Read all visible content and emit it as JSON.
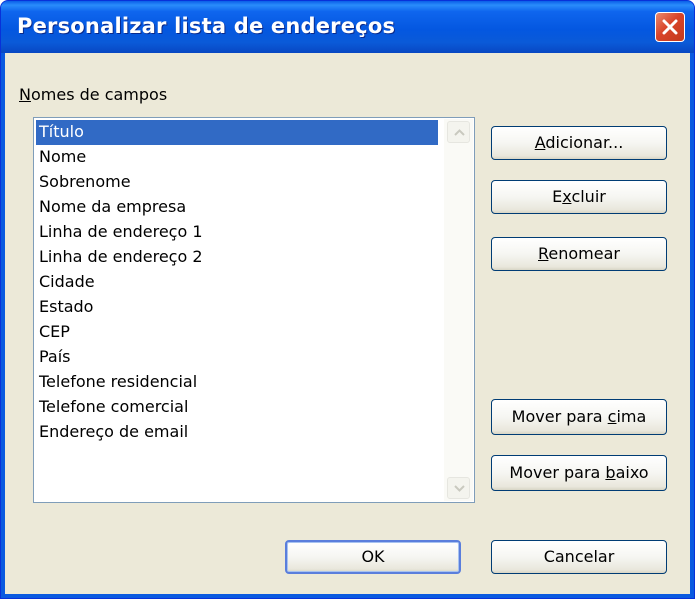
{
  "window": {
    "title": "Personalizar lista de endereços"
  },
  "group": {
    "label_accel": "N",
    "label_rest": "omes de campos"
  },
  "fields": [
    "Título",
    "Nome",
    "Sobrenome",
    "Nome da empresa",
    "Linha de endereço 1",
    "Linha de endereço 2",
    "Cidade",
    "Estado",
    "CEP",
    "País",
    "Telefone residencial",
    "Telefone comercial",
    "Endereço de email"
  ],
  "selected_index": 0,
  "buttons": {
    "add": {
      "pre": "",
      "acc": "A",
      "post": "dicionar..."
    },
    "delete": {
      "pre": "E",
      "acc": "x",
      "post": "cluir"
    },
    "rename": {
      "pre": "",
      "acc": "R",
      "post": "enomear"
    },
    "move_up": {
      "pre": "Mover para ",
      "acc": "c",
      "post": "ima"
    },
    "move_down": {
      "pre": "Mover para ",
      "acc": "b",
      "post": "aixo"
    },
    "ok": "OK",
    "cancel": "Cancelar"
  },
  "colors": {
    "titlebar": "#0a5ae0",
    "selection": "#316ac5",
    "dialog_face": "#ece9d8",
    "close_button": "#d9442a"
  },
  "icons": {
    "close": "close-icon",
    "scroll_up": "chevron-up-icon",
    "scroll_down": "chevron-down-icon"
  }
}
